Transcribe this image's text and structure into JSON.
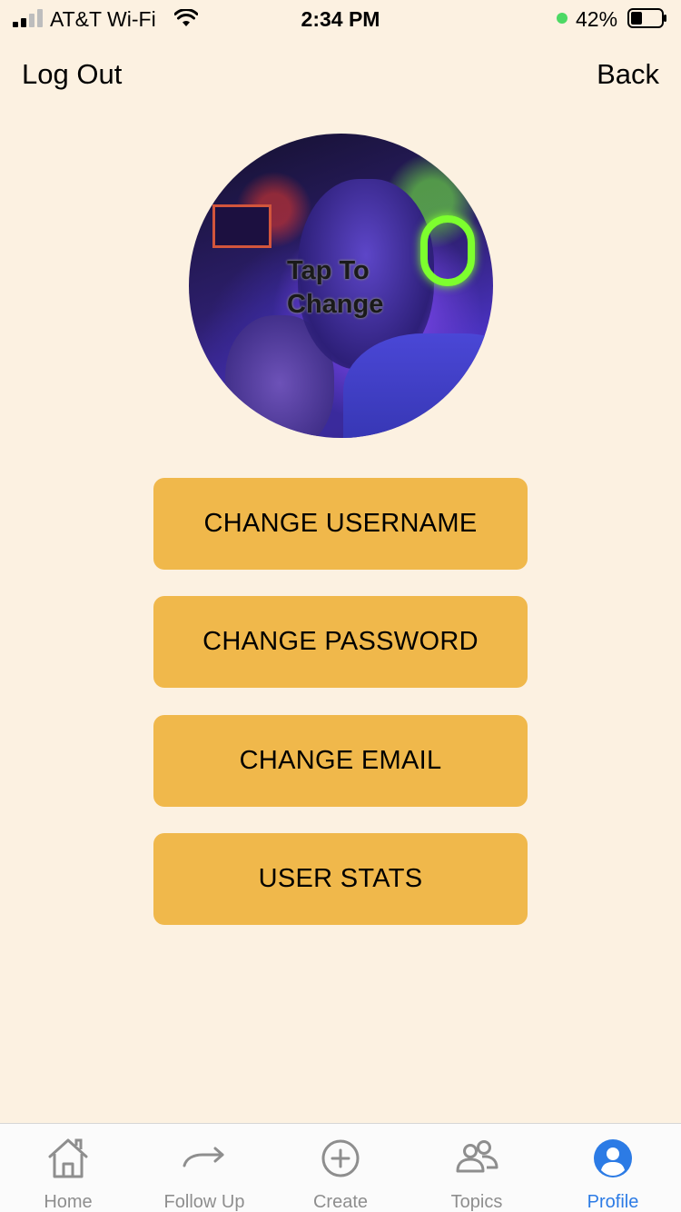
{
  "status_bar": {
    "carrier": "AT&T Wi-Fi",
    "time": "2:34 PM",
    "battery_percent": "42%",
    "battery_level": 0.42,
    "signal_bars_filled": 2,
    "signal_bars_total": 4
  },
  "nav": {
    "left_label": "Log Out",
    "right_label": "Back"
  },
  "avatar": {
    "overlay_text_line1": "Tap To",
    "overlay_text_line2": "Change"
  },
  "buttons": {
    "change_username": "CHANGE USERNAME",
    "change_password": "CHANGE PASSWORD",
    "change_email": "CHANGE EMAIL",
    "user_stats": "USER STATS"
  },
  "tabs": [
    {
      "label": "Home",
      "icon": "home-icon",
      "active": false
    },
    {
      "label": "Follow Up",
      "icon": "arrow-right-icon",
      "active": false
    },
    {
      "label": "Create",
      "icon": "plus-circle-icon",
      "active": false
    },
    {
      "label": "Topics",
      "icon": "users-icon",
      "active": false
    },
    {
      "label": "Profile",
      "icon": "profile-icon",
      "active": true
    }
  ],
  "colors": {
    "background": "#fcf1e1",
    "button": "#f0b84b",
    "tab_active": "#2c7be5",
    "tab_inactive": "#8e8e8e",
    "charging": "#4cd964"
  }
}
